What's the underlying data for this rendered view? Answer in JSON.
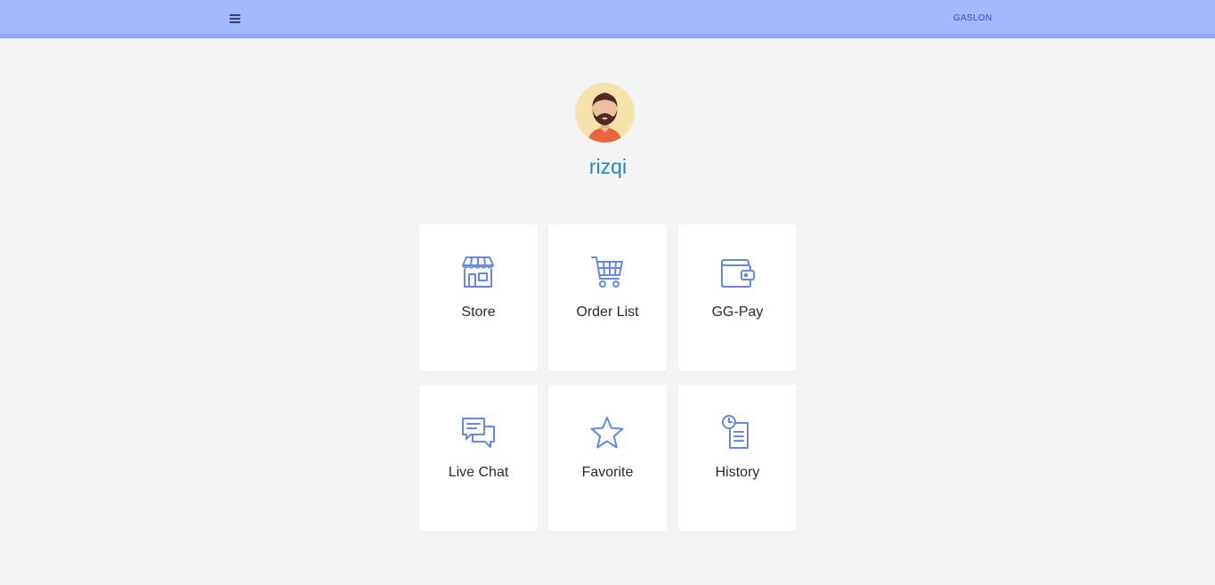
{
  "header": {
    "brand": "GASLON",
    "menu_icon": "hamburger-menu-icon"
  },
  "profile": {
    "username": "rizqi",
    "avatar_icon": "bearded-man-avatar"
  },
  "theme": {
    "topbar": "#a4b8fd",
    "accent": "#6488ee",
    "username_color": "#1e88c8",
    "background": "#f4f4f4"
  },
  "menu": {
    "items": [
      {
        "label": "Store",
        "icon": "store-icon"
      },
      {
        "label": "Order List",
        "icon": "cart-icon"
      },
      {
        "label": "GG-Pay",
        "icon": "wallet-icon"
      },
      {
        "label": "Live Chat",
        "icon": "chat-icon"
      },
      {
        "label": "Favorite",
        "icon": "star-icon"
      },
      {
        "label": "History",
        "icon": "history-icon"
      }
    ]
  }
}
